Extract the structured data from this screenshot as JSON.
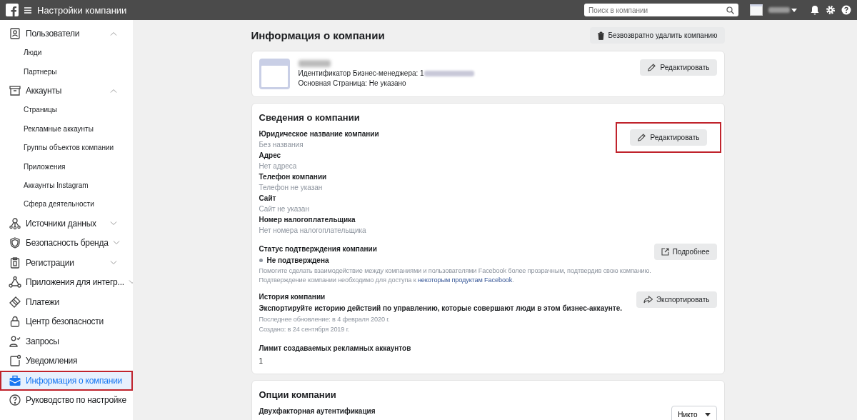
{
  "topbar": {
    "title": "Настройки компании",
    "search": {
      "placeholder": "Поиск в компании"
    }
  },
  "sidebar": {
    "items": [
      {
        "label": "Пользователи",
        "expanded": true,
        "selected": false,
        "highlighted": false,
        "children": [
          {
            "label": "Люди"
          },
          {
            "label": "Партнеры"
          }
        ]
      },
      {
        "label": "Аккаунты",
        "expanded": true,
        "selected": false,
        "highlighted": false,
        "children": [
          {
            "label": "Страницы"
          },
          {
            "label": "Рекламные аккаунты"
          },
          {
            "label": "Группы объектов компании"
          },
          {
            "label": "Приложения"
          },
          {
            "label": "Аккаунты Instagram"
          },
          {
            "label": "Сфера деятельности"
          }
        ]
      },
      {
        "label": "Источники данных",
        "expanded": false,
        "selected": false,
        "highlighted": false
      },
      {
        "label": "Безопасность бренда",
        "expanded": false,
        "selected": false,
        "highlighted": false
      },
      {
        "label": "Регистрации",
        "expanded": false,
        "selected": false,
        "highlighted": false
      },
      {
        "label": "Приложения для интегр...",
        "expanded": false,
        "selected": false,
        "highlighted": false
      },
      {
        "label": "Платежи",
        "selected": false,
        "highlighted": false
      },
      {
        "label": "Центр безопасности",
        "selected": false,
        "highlighted": false
      },
      {
        "label": "Запросы",
        "selected": false,
        "highlighted": false
      },
      {
        "label": "Уведомления",
        "selected": false,
        "highlighted": false
      },
      {
        "label": "Информация о компании",
        "selected": true,
        "highlighted": true
      },
      {
        "label": "Руководство по настройке",
        "selected": false,
        "highlighted": false
      }
    ]
  },
  "page": {
    "title": "Информация о компании",
    "delete_button": "Безвозвратно удалить компанию"
  },
  "company_card": {
    "id_line": "Идентификатор Бизнес-менеджера: 1",
    "main_page": "Основная Страница: Не указано",
    "edit_button": "Редактировать"
  },
  "details": {
    "title": "Сведения о компании",
    "edit_button": "Редактировать",
    "highlighted": true,
    "fields": [
      {
        "label": "Юридическое название компании",
        "value": "Без названия"
      },
      {
        "label": "Адрес",
        "value": "Нет адреса"
      },
      {
        "label": "Телефон компании",
        "value": "Телефон не указан"
      },
      {
        "label": "Сайт",
        "value": "Сайт не указан"
      },
      {
        "label": "Номер налогоплательщика",
        "value": "Нет номера налогоплательщика"
      }
    ],
    "verification": {
      "title": "Статус подтверждения компании",
      "status": "Не подтверждена",
      "description": "Помогите сделать взаимодействие между компаниями и пользователями Facebook более прозрачным, подтвердив свою компанию.",
      "note": "Подтверждение компании необходимо для доступа к ",
      "link": "некоторым продуктам Facebook",
      "note_end": ".",
      "button": "Подробнее"
    },
    "history": {
      "title": "История компании",
      "text": "Экспортируйте историю действий по управлению, которые совершают люди в этом бизнес-аккаунте.",
      "updated": "Последнее обновление: в 4 февраля 2020 г.",
      "created": "Создано: в 24 сентября 2019 г.",
      "button": "Экспортировать"
    },
    "limit": {
      "title": "Лимит создаваемых рекламных аккаунтов",
      "value": "1"
    }
  },
  "options": {
    "title": "Опции компании",
    "two_factor": {
      "label": "Двухфакторная аутентификация",
      "value": "Никто"
    }
  }
}
